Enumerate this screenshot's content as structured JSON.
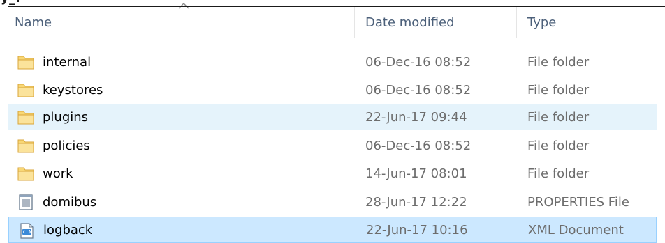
{
  "top_clipped_text": "y_r",
  "columns": {
    "name": "Name",
    "date_modified": "Date modified",
    "type": "Type"
  },
  "rows": [
    {
      "name": "internal",
      "date": "06-Dec-16 08:52",
      "type": "File folder",
      "icon": "folder-icon"
    },
    {
      "name": "keystores",
      "date": "06-Dec-16 08:52",
      "type": "File folder",
      "icon": "folder-icon"
    },
    {
      "name": "plugins",
      "date": "22-Jun-17 09:44",
      "type": "File folder",
      "icon": "folder-icon"
    },
    {
      "name": "policies",
      "date": "06-Dec-16 08:52",
      "type": "File folder",
      "icon": "folder-icon"
    },
    {
      "name": "work",
      "date": "14-Jun-17 08:01",
      "type": "File folder",
      "icon": "folder-icon"
    },
    {
      "name": "domibus",
      "date": "28-Jun-17 12:22",
      "type": "PROPERTIES File",
      "icon": "text-file-icon"
    },
    {
      "name": "logback",
      "date": "22-Jun-17 10:16",
      "type": "XML Document",
      "icon": "xml-file-icon"
    }
  ],
  "colors": {
    "header_text": "#4c607a",
    "secondary_text": "#6d6d6d",
    "hover_row": "#e5f3fb",
    "selected_row": "#cce8ff",
    "selected_border": "#99d1ff",
    "folder_yellow": "#f8d775"
  },
  "state": {
    "hovered_row": "plugins",
    "selected_row": "logback"
  }
}
